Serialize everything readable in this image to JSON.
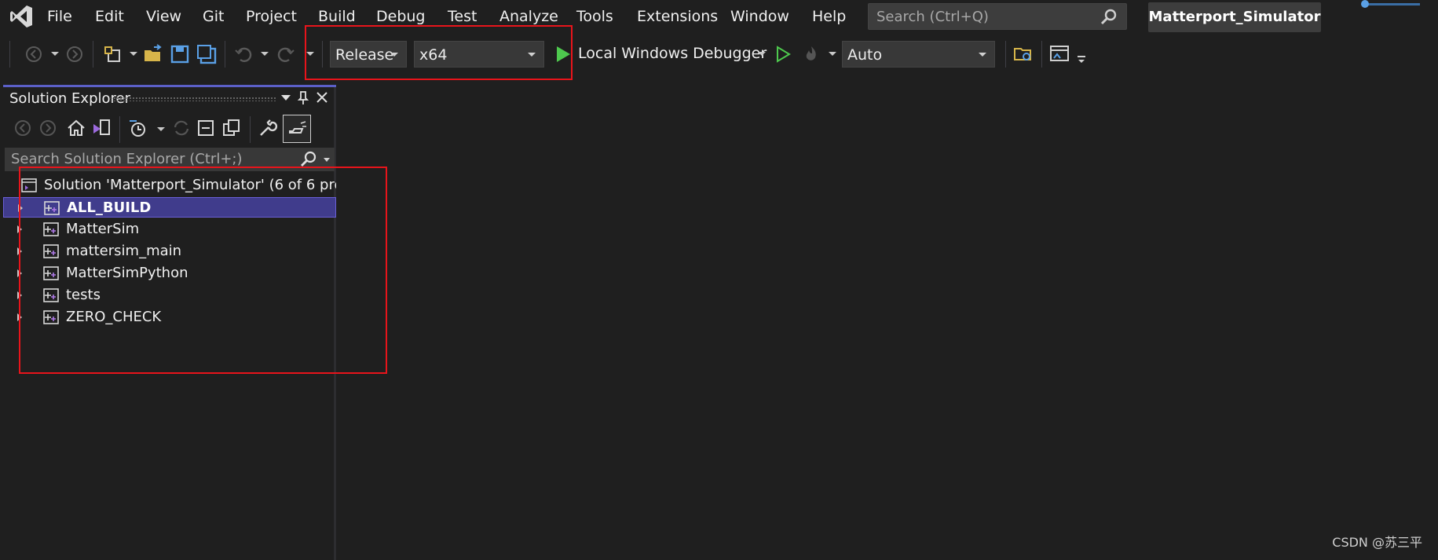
{
  "app": {
    "solution_badge": "Matterport_Simulator"
  },
  "menu": [
    {
      "label": "File",
      "name": "menu-file"
    },
    {
      "label": "Edit",
      "name": "menu-edit"
    },
    {
      "label": "View",
      "name": "menu-view"
    },
    {
      "label": "Git",
      "name": "menu-git"
    },
    {
      "label": "Project",
      "name": "menu-project"
    },
    {
      "label": "Build",
      "name": "menu-build"
    },
    {
      "label": "Debug",
      "name": "menu-debug"
    },
    {
      "label": "Test",
      "name": "menu-test"
    },
    {
      "label": "Analyze",
      "name": "menu-analyze"
    },
    {
      "label": "Tools",
      "name": "menu-tools"
    },
    {
      "label": "Extensions",
      "name": "menu-extensions"
    },
    {
      "label": "Window",
      "name": "menu-window"
    },
    {
      "label": "Help",
      "name": "menu-help"
    }
  ],
  "search": {
    "placeholder": "Search (Ctrl+Q)"
  },
  "toolbar": {
    "configuration": "Release",
    "platform": "x64",
    "debugger": "Local Windows Debugger",
    "stack_frame": "Auto"
  },
  "solution_explorer": {
    "title": "Solution Explorer",
    "search_placeholder": "Search Solution Explorer (Ctrl+;)",
    "solution_label": "Solution 'Matterport_Simulator' (6 of 6 pro",
    "projects": [
      {
        "label": "ALL_BUILD",
        "selected": true
      },
      {
        "label": "MatterSim",
        "selected": false
      },
      {
        "label": "mattersim_main",
        "selected": false
      },
      {
        "label": "MatterSimPython",
        "selected": false
      },
      {
        "label": "tests",
        "selected": false
      },
      {
        "label": "ZERO_CHECK",
        "selected": false
      }
    ]
  },
  "watermark": "CSDN @苏三平",
  "colors": {
    "background": "#1f1f1f",
    "selection": "#403c8c",
    "highlight_box": "#e8141b",
    "accent_green": "#4ec94e"
  }
}
